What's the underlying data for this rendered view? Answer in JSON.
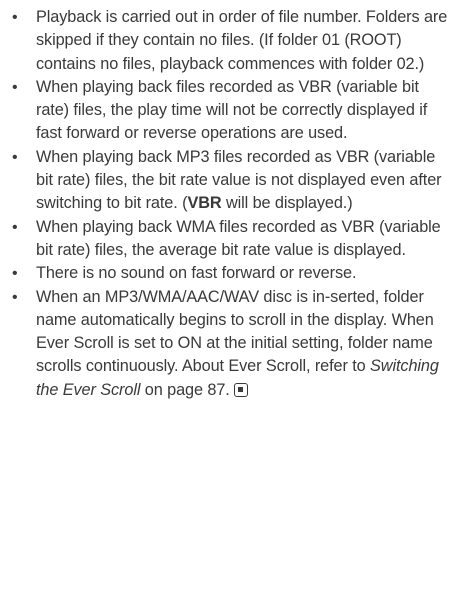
{
  "notes": [
    {
      "text": "Playback is carried out in order of file number. Folders are skipped if they contain no files. (If folder 01 (ROOT) contains no files, playback commences with folder 02.)"
    },
    {
      "text": "When playing back files recorded as VBR (variable bit rate) files, the play time will not be correctly displayed if fast forward or reverse operations are used."
    },
    {
      "text_before": "When playing back MP3 files recorded as VBR (variable bit rate) files, the bit rate value is not displayed even after switching to bit rate. (",
      "bold": "VBR",
      "text_after": " will be displayed.)"
    },
    {
      "text": "When playing back WMA files recorded as VBR (variable bit rate) files, the average bit rate value is displayed."
    },
    {
      "text": "There is no sound on fast forward or reverse."
    },
    {
      "text_before": "When an MP3/WMA/AAC/WAV disc is in-serted, folder name automatically begins to scroll in the display. When Ever Scroll is set to ON at the initial setting, folder name scrolls continuously. About Ever Scroll, refer to ",
      "italic": "Switching the Ever Scroll",
      "text_after": " on page 87."
    }
  ],
  "bullet_glyph": "•",
  "icons": {
    "end_mark": "end-of-section-icon"
  }
}
